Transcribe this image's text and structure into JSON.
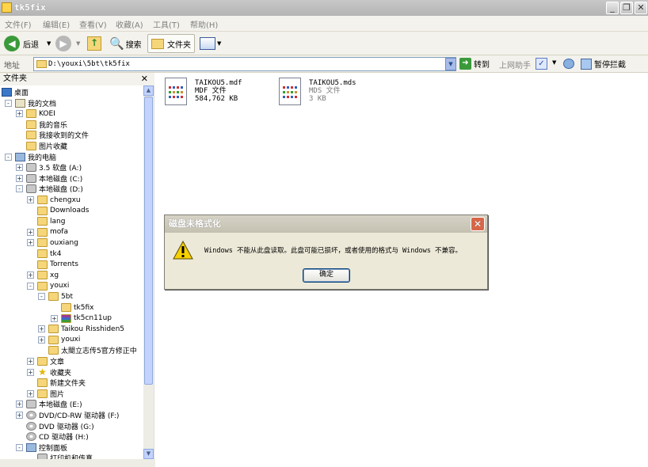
{
  "window": {
    "title": "tk5fix"
  },
  "menu": [
    "文件(F)",
    "编辑(E)",
    "查看(V)",
    "收藏(A)",
    "工具(T)",
    "帮助(H)"
  ],
  "toolbar": {
    "back": "后退",
    "search": "搜索",
    "folders": "文件夹"
  },
  "address": {
    "label": "地址",
    "path": "D:\\youxi\\5bt\\tk5fix",
    "go": "转到",
    "helper": "上网助手",
    "block": "暂停拦截"
  },
  "sidebar": {
    "title": "文件夹",
    "tree": [
      {
        "label": "桌面",
        "icon": "desktop-icon",
        "level": 0,
        "pm": ""
      },
      {
        "label": "我的文档",
        "icon": "doc-icon",
        "level": 1,
        "pm": "-"
      },
      {
        "label": "KOEI",
        "icon": "folder-icon",
        "level": 2,
        "pm": "+"
      },
      {
        "label": "我的音乐",
        "icon": "folder-icon",
        "level": 2,
        "pm": ""
      },
      {
        "label": "我接收到的文件",
        "icon": "folder-icon",
        "level": 2,
        "pm": ""
      },
      {
        "label": "图片收藏",
        "icon": "folder-icon",
        "level": 2,
        "pm": ""
      },
      {
        "label": "我的电脑",
        "icon": "computer-icon",
        "level": 1,
        "pm": "-"
      },
      {
        "label": "3.5 软盘 (A:)",
        "icon": "floppy-icon",
        "level": 2,
        "pm": "+"
      },
      {
        "label": "本地磁盘 (C:)",
        "icon": "drive-icon",
        "level": 2,
        "pm": "+"
      },
      {
        "label": "本地磁盘 (D:)",
        "icon": "drive-icon",
        "level": 2,
        "pm": "-"
      },
      {
        "label": "chengxu",
        "icon": "folder-icon",
        "level": 3,
        "pm": "+"
      },
      {
        "label": "Downloads",
        "icon": "folder-icon",
        "level": 3,
        "pm": ""
      },
      {
        "label": "lang",
        "icon": "folder-icon",
        "level": 3,
        "pm": ""
      },
      {
        "label": "mofa",
        "icon": "folder-icon",
        "level": 3,
        "pm": "+"
      },
      {
        "label": "ouxiang",
        "icon": "folder-icon",
        "level": 3,
        "pm": "+"
      },
      {
        "label": "tk4",
        "icon": "folder-icon",
        "level": 3,
        "pm": ""
      },
      {
        "label": "Torrents",
        "icon": "folder-icon",
        "level": 3,
        "pm": ""
      },
      {
        "label": "xg",
        "icon": "folder-icon",
        "level": 3,
        "pm": "+"
      },
      {
        "label": "youxi",
        "icon": "folder-icon",
        "level": 3,
        "pm": "-"
      },
      {
        "label": "5bt",
        "icon": "folder-icon",
        "level": 4,
        "pm": "-"
      },
      {
        "label": "tk5fix",
        "icon": "folder-open-icon",
        "level": 5,
        "pm": ""
      },
      {
        "label": "tk5cn11up",
        "icon": "archive-icon",
        "level": 5,
        "pm": "+"
      },
      {
        "label": "Taikou Risshiden5",
        "icon": "folder-icon",
        "level": 4,
        "pm": "+"
      },
      {
        "label": "youxi",
        "icon": "folder-icon",
        "level": 4,
        "pm": "+"
      },
      {
        "label": "太閤立志传5官方修正中",
        "icon": "folder-icon",
        "level": 4,
        "pm": ""
      },
      {
        "label": "文章",
        "icon": "folder-icon",
        "level": 3,
        "pm": "+"
      },
      {
        "label": "收藏夹",
        "icon": "star-icon",
        "level": 3,
        "pm": "+"
      },
      {
        "label": "新建文件夹",
        "icon": "folder-icon",
        "level": 3,
        "pm": ""
      },
      {
        "label": "图片",
        "icon": "folder-icon",
        "level": 3,
        "pm": "+"
      },
      {
        "label": "本地磁盘 (E:)",
        "icon": "drive-icon",
        "level": 2,
        "pm": "+"
      },
      {
        "label": "DVD/CD-RW 驱动器 (F:)",
        "icon": "cd-icon",
        "level": 2,
        "pm": "+"
      },
      {
        "label": "DVD 驱动器 (G:)",
        "icon": "cd-icon",
        "level": 2,
        "pm": ""
      },
      {
        "label": "CD 驱动器 (H:)",
        "icon": "cd-icon",
        "level": 2,
        "pm": ""
      },
      {
        "label": "控制面板",
        "icon": "control-panel-icon",
        "level": 2,
        "pm": "-"
      },
      {
        "label": "打印机和传真",
        "icon": "printer-icon",
        "level": 3,
        "pm": ""
      }
    ]
  },
  "files": [
    {
      "name": "TAIKOU5.mdf",
      "type": "MDF 文件",
      "size": "584,762 KB"
    },
    {
      "name": "TAIKOU5.mds",
      "type": "MDS 文件",
      "size": "3 KB"
    }
  ],
  "dialog": {
    "title": "磁盘未格式化",
    "message": "Windows 不能从此盘读取。此盘可能已损坏，或者使用的格式与 Windows 不兼容。",
    "ok": "确定"
  }
}
